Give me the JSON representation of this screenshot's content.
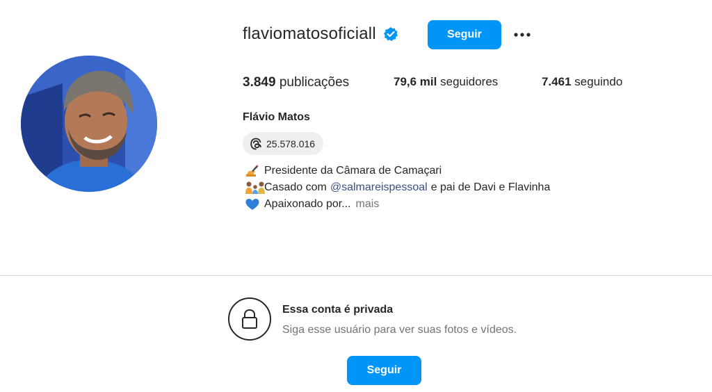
{
  "colors": {
    "accent": "#0095f6",
    "verified": "#0095f6",
    "text_primary": "#262626",
    "text_secondary": "#737373",
    "mention": "#385185",
    "pill_bg": "#efefef"
  },
  "profile": {
    "avatar_icon": "profile-photo",
    "username": "flaviomatosoficiall",
    "verified_icon": "verified-badge-icon",
    "follow_label": "Seguir",
    "more_icon": "more-options-icon"
  },
  "stats": {
    "posts_count": "3.849",
    "posts_label": "publicações",
    "followers_count": "79,6 mil",
    "followers_label": "seguidores",
    "following_count": "7.461",
    "following_label": "seguindo"
  },
  "name": "Flávio Matos",
  "threads": {
    "icon": "threads-icon",
    "count": "25.578.016"
  },
  "bio": {
    "line1_emoji": "writing-hand-icon",
    "line1": "Presidente da Câmara de Camaçari",
    "line2_emoji": "family-icon",
    "line2_prefix": "Casado com",
    "line2_mention": "@salmareispessoal",
    "line2_suffix": "e pai de Davi e Flavinha",
    "line3_emoji": "blue-heart-icon",
    "line3": "Apaixonado por...",
    "more": "mais"
  },
  "private": {
    "icon": "lock-icon",
    "title": "Essa conta é privada",
    "subtitle": "Siga esse usuário para ver suas fotos e vídeos.",
    "follow_label": "Seguir"
  }
}
